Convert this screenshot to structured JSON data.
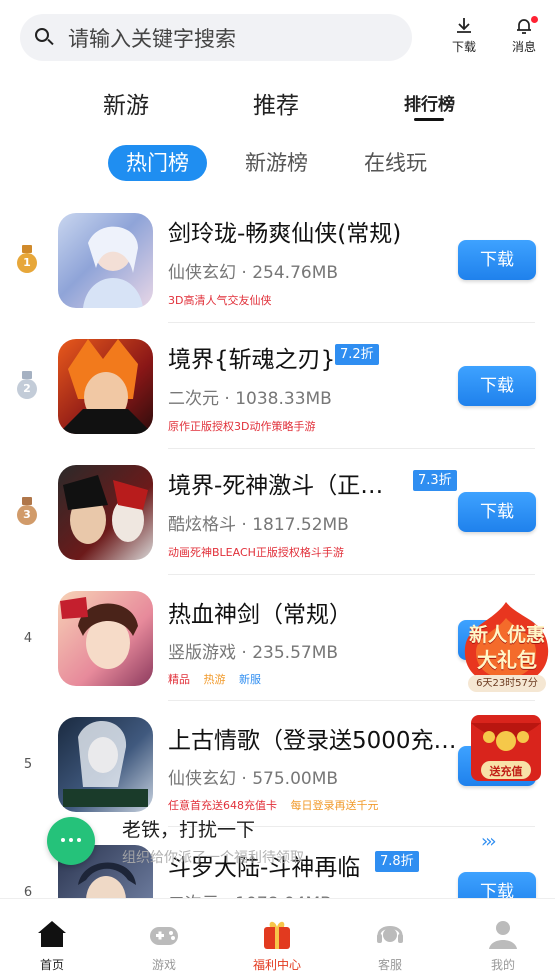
{
  "header": {
    "search_placeholder": "请输入关键字搜索",
    "download_label": "下载",
    "message_label": "消息"
  },
  "main_tabs": [
    {
      "label": "新游"
    },
    {
      "label": "推荐"
    },
    {
      "label": "排行榜",
      "active": true
    }
  ],
  "sub_tabs": [
    {
      "label": "热门榜",
      "active": true
    },
    {
      "label": "新游榜"
    },
    {
      "label": "在线玩"
    }
  ],
  "games": [
    {
      "rank": "1",
      "name": "剑玲珑-畅爽仙侠(常规)",
      "discount": "",
      "category": "仙侠玄幻",
      "size": "254.76MB",
      "tagline": "3D高清人气交友仙侠",
      "button": "下载"
    },
    {
      "rank": "2",
      "name": "境界{斩魂之刃}",
      "discount": "7.2折",
      "category": "二次元",
      "size": "1038.33MB",
      "tagline": "原作正版授权3D动作策略手游",
      "button": "下载"
    },
    {
      "rank": "3",
      "name": "境界-死神激斗（正…",
      "discount": "7.3折",
      "category": "酷炫格斗",
      "size": "1817.52MB",
      "tagline": "动画死神BLEACH正版授权格斗手游",
      "button": "下载"
    },
    {
      "rank": "4",
      "name": "热血神剑（常规）",
      "discount": "",
      "category": "竖版游戏",
      "size": "235.57MB",
      "tags": [
        "精品",
        "热游",
        "新服"
      ],
      "button": "下载"
    },
    {
      "rank": "5",
      "name": "上古情歌（登录送5000充…",
      "discount": "",
      "category": "仙侠玄幻",
      "size": "575.00MB",
      "tags": [
        "任意首充送648充值卡",
        "每日登录再送千元"
      ],
      "button": "下载"
    },
    {
      "rank": "6",
      "name": "斗罗大陆-斗神再临",
      "discount": "7.8折",
      "category": "二次元",
      "size": "1078.04MB",
      "tagline": "",
      "button": "下载"
    }
  ],
  "promos": {
    "gift_line1": "新人优惠",
    "gift_line2": "大礼包",
    "gift_timer": "6天23时57分",
    "redpacket_label": "送充值"
  },
  "chat": {
    "title": "老铁，打扰一下",
    "subtitle": "组织给你派了一个福利待领取",
    "chevrons": "›››"
  },
  "bottom_nav": [
    {
      "label": "首页",
      "active": true
    },
    {
      "label": "游戏"
    },
    {
      "label": "福利中心"
    },
    {
      "label": "客服"
    },
    {
      "label": "我的"
    }
  ],
  "colors": {
    "accent": "#1f8ef1",
    "tagline_red": "#e1303a",
    "chat_green": "#25c27a"
  }
}
